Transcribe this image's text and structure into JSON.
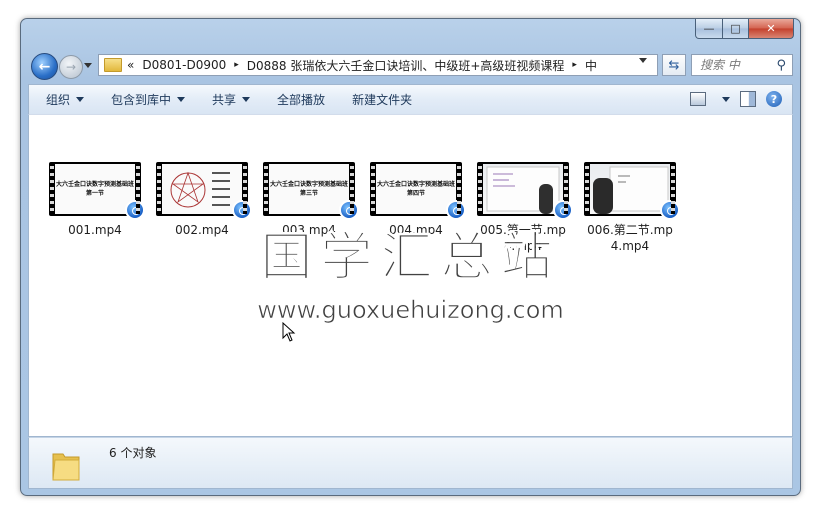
{
  "window": {
    "caption": {
      "minimize": "—",
      "maximize": "□",
      "close": "✕"
    }
  },
  "address": {
    "overflow": "«",
    "crumbs": [
      "D0801-D0900",
      "D0888 张瑞依大六壬金口诀培训、中级班+高级班视频课程",
      "中"
    ],
    "separator": "▸"
  },
  "search": {
    "placeholder": "搜索 中"
  },
  "toolbar": {
    "organize": "组织",
    "include_in_library": "包含到库中",
    "share": "共享",
    "play_all": "全部播放",
    "new_folder": "新建文件夹"
  },
  "files": [
    {
      "name": "001.mp4",
      "slide": "大六壬金口诀数字预测基础班\n第一节"
    },
    {
      "name": "002.mp4",
      "slide": ""
    },
    {
      "name": "003.mp4",
      "slide": "大六壬金口诀数字预测基础班\n第三节"
    },
    {
      "name": "004.mp4",
      "slide": "大六壬金口诀数字预测基础班\n第四节"
    },
    {
      "name": "005.第一节.mp4.mp4",
      "slide": ""
    },
    {
      "name": "006.第二节.mp4.mp4",
      "slide": ""
    }
  ],
  "watermark": {
    "cn": "国学汇总站",
    "url": "www.guoxuehuizong.com"
  },
  "status": {
    "count": "6 个对象"
  },
  "colors": {
    "frame": "#aac6e4",
    "toolbar_text": "#1e395b",
    "badge": "#1a61c7"
  }
}
